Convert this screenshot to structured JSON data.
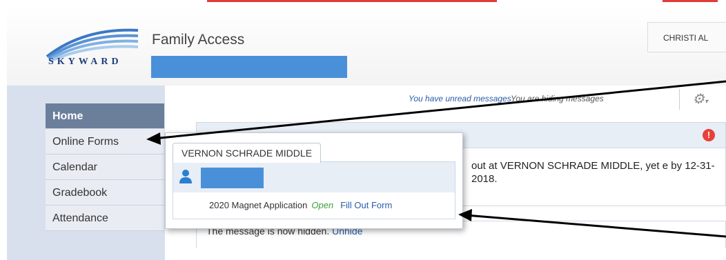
{
  "header": {
    "brand": "SKYWARD",
    "app_title": "Family Access",
    "user_label": "CHRISTI AL"
  },
  "messages": {
    "unread": "You have unread messages",
    "hiding": "You are hiding messages"
  },
  "sidebar": {
    "items": [
      {
        "label": "Home"
      },
      {
        "label": "Online Forms"
      },
      {
        "label": "Calendar"
      },
      {
        "label": "Gradebook"
      },
      {
        "label": "Attendance"
      }
    ]
  },
  "card": {
    "text": "out at VERNON SCHRADE MIDDLE, yet e by 12-31-2018."
  },
  "card2": {
    "text": "The message is now hidden.",
    "link": "Unhide"
  },
  "popup": {
    "school": "VERNON SCHRADE MIDDLE",
    "form_name": "2020 Magnet Application",
    "status": "Open",
    "action": "Fill Out Form"
  },
  "colors": {
    "accent_blue": "#4a90d9",
    "nav_active": "#6b7f9b",
    "alert_red": "#e8413a",
    "open_green": "#3aa03a",
    "link_blue": "#2a5caa"
  },
  "icons": {
    "settings": "gear-icon",
    "alert": "alert-icon",
    "student": "person-icon"
  }
}
